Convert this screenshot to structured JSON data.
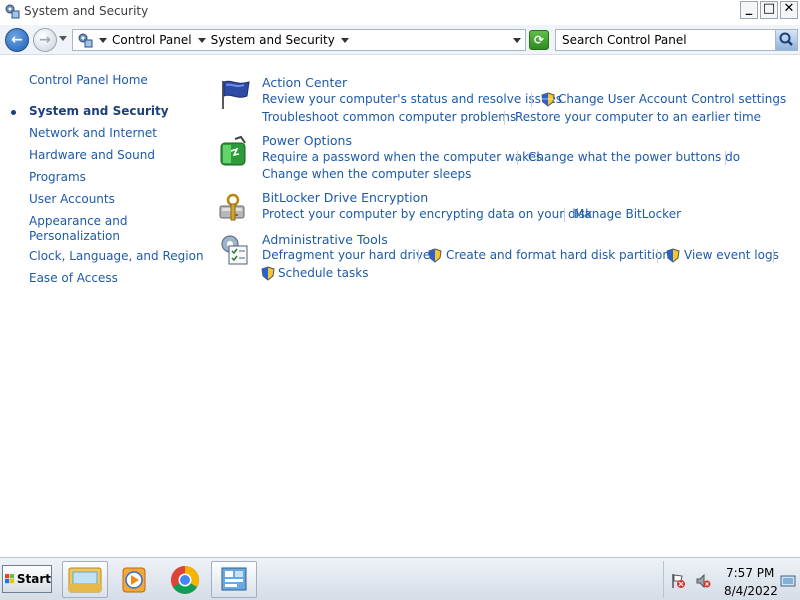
{
  "window": {
    "title": "System and Security",
    "buttons": {
      "minimize": "_",
      "restore": "□",
      "close": "✕"
    }
  },
  "address_bar": {
    "breadcrumbs": [
      "Control Panel",
      "System and Security"
    ],
    "search_placeholder": "Search Control Panel"
  },
  "left_nav": {
    "home": "Control Panel Home",
    "items": [
      {
        "label": "System and Security",
        "current": true
      },
      {
        "label": "Network and Internet"
      },
      {
        "label": "Hardware and Sound"
      },
      {
        "label": "Programs"
      },
      {
        "label": "User Accounts"
      },
      {
        "label": "Appearance and"
      },
      {
        "label": "Personalization"
      },
      {
        "label": "Clock, Language, and Region"
      },
      {
        "label": "Ease of Access"
      }
    ]
  },
  "categories": {
    "action_center": {
      "title": "Action Center",
      "links": [
        "Review your computer's status and resolve issues",
        "Change User Account Control settings",
        "Troubleshoot common computer problems",
        "Restore your computer to an earlier time"
      ]
    },
    "power_options": {
      "title": "Power Options",
      "links": [
        "Require a password when the computer wakes",
        "Change what the power buttons do",
        "Change when the computer sleeps"
      ]
    },
    "bitlocker": {
      "title": "BitLocker Drive Encryption",
      "links": [
        "Protect your computer by encrypting data on your disk",
        "Manage BitLocker"
      ]
    },
    "admin_tools": {
      "title": "Administrative Tools",
      "links": [
        "Defragment your hard drive",
        "Create and format hard disk partitions",
        "View event logs",
        "Schedule tasks"
      ]
    }
  },
  "taskbar": {
    "start_label": "Start",
    "apps": [
      "file-explorer-icon",
      "media-player-icon",
      "chrome-icon",
      "control-panel-icon"
    ],
    "clock": {
      "time": "7:57 PM",
      "date": "8/4/2022"
    }
  }
}
